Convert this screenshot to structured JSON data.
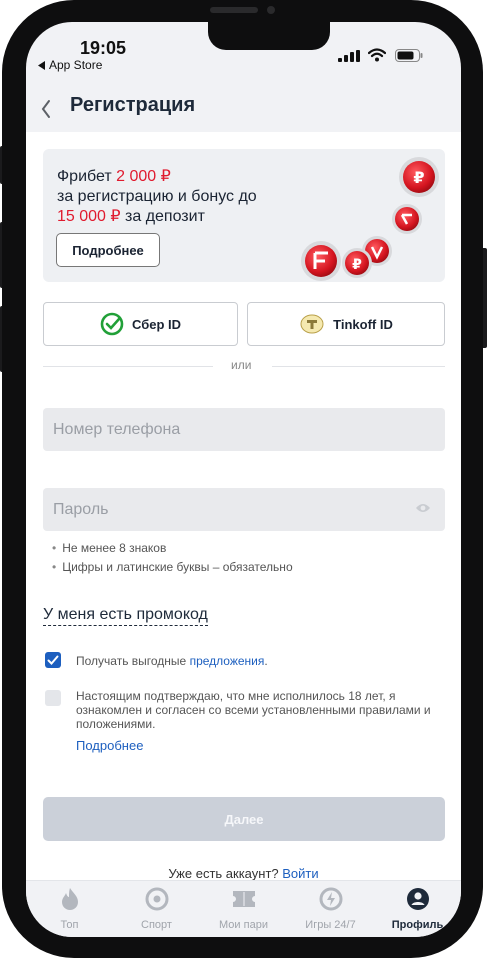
{
  "status_bar": {
    "time": "19:05",
    "back_app": "App Store"
  },
  "header": {
    "back_icon": "chevron-left-icon",
    "title": "Регистрация"
  },
  "promo": {
    "line1_prefix": "Фрибет ",
    "line1_amount": "2 000 ₽",
    "line2": "за регистрацию и бонус до",
    "line3_amount": "15 000 ₽",
    "line3_suffix": " за депозит",
    "button": "Подробнее",
    "accent_color": "#e01b2f"
  },
  "social": {
    "sber": "Сбер ID",
    "tinkoff": "Tinkoff ID",
    "or": "или"
  },
  "form": {
    "phone_placeholder": "Номер телефона",
    "password_placeholder": "Пароль",
    "hints": [
      "Не менее 8 знаков",
      "Цифры и латинские буквы – обязательно"
    ],
    "promo_code": "У меня есть промокод"
  },
  "checkboxes": {
    "offers_text": "Получать выгодные ",
    "offers_link": "предложения",
    "offers_dot": ".",
    "offers_checked": true,
    "age_text": "Настоящим подтверждаю, что мне исполнилось 18 лет, я ознакомлен и согласен со всеми установленными правилами и положениями.",
    "age_checked": false,
    "details_link": "Подробнее"
  },
  "next_button": "Далее",
  "login": {
    "text": "Уже есть аккаунт? ",
    "link": "Войти"
  },
  "tabs": [
    {
      "label": "Топ",
      "icon": "fire-icon"
    },
    {
      "label": "Спорт",
      "icon": "target-icon"
    },
    {
      "label": "Мои пари",
      "icon": "ticket-icon"
    },
    {
      "label": "Игры 24/7",
      "icon": "lightning-icon"
    },
    {
      "label": "Профиль",
      "icon": "profile-icon",
      "active": true
    }
  ],
  "colors": {
    "primary": "#1d5fbf",
    "title": "#1e2a3a",
    "disabled_button": "#cbd0d9"
  }
}
